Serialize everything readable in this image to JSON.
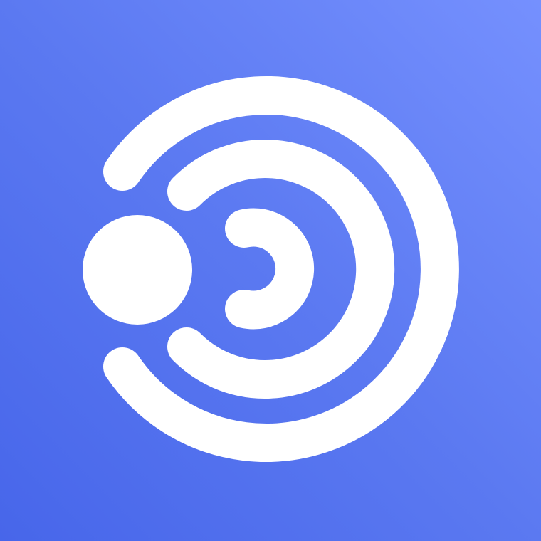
{
  "app_icon": {
    "icon": "signal-broadcast-logo-icon",
    "colors": {
      "background_start": "#4766ea",
      "background_end": "#7590fe",
      "foreground": "#ffffff"
    }
  }
}
